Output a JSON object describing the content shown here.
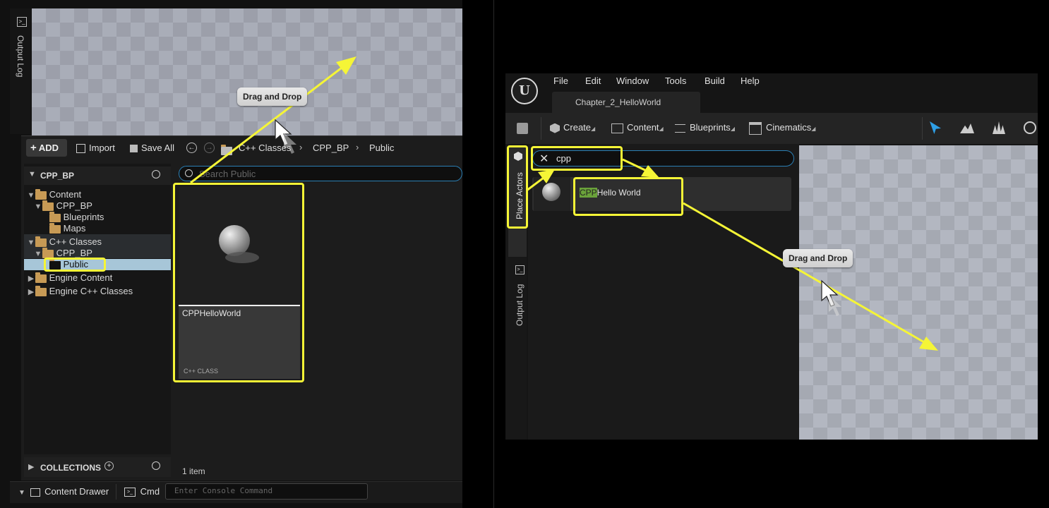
{
  "left": {
    "output_log_label": "Output Log",
    "drag_drop_label": "Drag and Drop",
    "toolbar": {
      "add_label": "ADD",
      "import_label": "Import",
      "save_all_label": "Save All",
      "breadcrumb": [
        "C++ Classes",
        "CPP_BP",
        "Public"
      ]
    },
    "sources_header": "CPP_BP",
    "search_placeholder": "Search Public",
    "tree": {
      "content": "Content",
      "cpp_bp": "CPP_BP",
      "blueprints": "Blueprints",
      "maps": "Maps",
      "cpp_classes": "C++ Classes",
      "cpp_bp_sub": "CPP_BP",
      "public": "Public",
      "engine_content": "Engine Content",
      "engine_cpp": "Engine C++ Classes"
    },
    "asset": {
      "name": "CPPHelloWorld",
      "type": "C++ CLASS"
    },
    "item_count": "1 item",
    "collections_label": "COLLECTIONS",
    "content_drawer_label": "Content Drawer",
    "cmd_label": "Cmd",
    "console_placeholder": "Enter Console Command"
  },
  "right": {
    "menu": [
      "File",
      "Edit",
      "Window",
      "Tools",
      "Build",
      "Help"
    ],
    "tab_title": "Chapter_2_HelloWorld",
    "toolbar": {
      "create": "Create",
      "content": "Content",
      "blueprints": "Blueprints",
      "cinematics": "Cinematics"
    },
    "place_actors_label": "Place Actors",
    "output_log_label": "Output Log",
    "search_value": "cpp",
    "result_highlight": "CPP",
    "result_rest": "Hello World",
    "drag_drop_label": "Drag and Drop"
  },
  "colors": {
    "callout": "#f5f536",
    "panel": "#1a1a1a",
    "selected_row": "#a7c6d8",
    "search_border": "#2b7fb4",
    "match_highlight": "#6aa23a"
  }
}
